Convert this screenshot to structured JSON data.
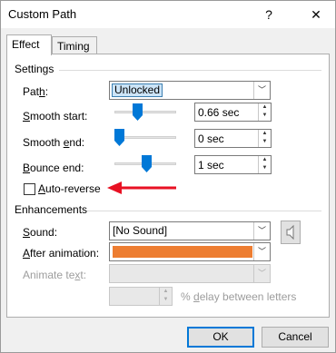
{
  "window": {
    "title": "Custom Path",
    "help_glyph": "?",
    "close_glyph": "✕"
  },
  "tabs": [
    {
      "label": "Effect",
      "active": true
    },
    {
      "label": "Timing",
      "active": false
    }
  ],
  "settings": {
    "heading": "Settings",
    "path": {
      "label_pre": "Pat",
      "label_u": "h",
      "label_post": ":",
      "value": "Unlocked"
    },
    "smooth_start": {
      "label_pre": "",
      "label_u": "S",
      "label_post": "mooth start:",
      "value": "0.66 sec"
    },
    "smooth_end": {
      "label_pre": "Smooth ",
      "label_u": "e",
      "label_post": "nd:",
      "value": "0 sec"
    },
    "bounce_end": {
      "label_pre": "",
      "label_u": "B",
      "label_post": "ounce end:",
      "value": "1 sec"
    },
    "auto_reverse": {
      "label_pre": "",
      "label_u": "A",
      "label_post": "uto-reverse",
      "checked": false
    }
  },
  "enhancements": {
    "heading": "Enhancements",
    "sound": {
      "label_pre": "",
      "label_u": "S",
      "label_post": "ound:",
      "value": "[No Sound]"
    },
    "after_animation": {
      "label_pre": "",
      "label_u": "A",
      "label_post": "fter animation:",
      "color": "#ed7d31"
    },
    "animate_text": {
      "label_pre": "Animate te",
      "label_u": "x",
      "label_post": "t:",
      "value": ""
    },
    "delay": {
      "value": "",
      "label_pre": "% ",
      "label_u": "d",
      "label_post": "elay between letters"
    }
  },
  "footer": {
    "ok_label": "OK",
    "cancel_label": "Cancel"
  },
  "colors": {
    "accent": "#0078d7",
    "arrow_red": "#e81123"
  }
}
